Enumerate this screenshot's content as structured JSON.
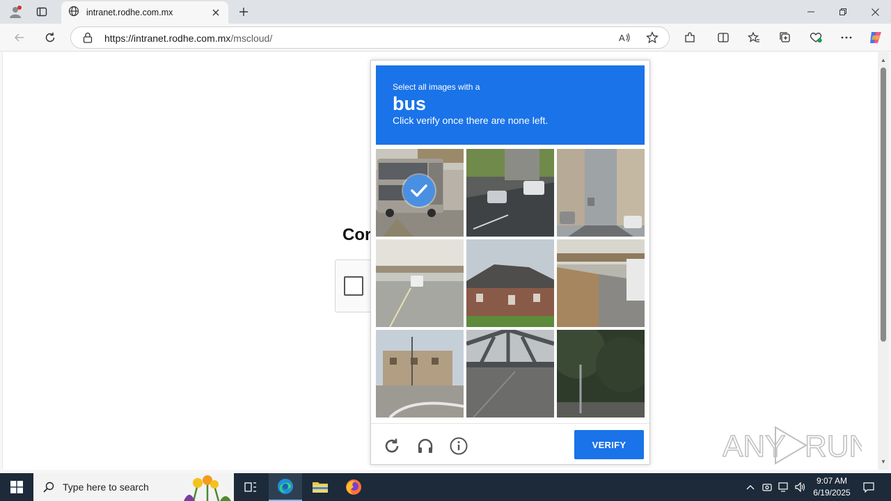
{
  "browser": {
    "tab_title": "intranet.rodhe.com.mx",
    "url_host": "https://intranet.rodhe.com.mx",
    "url_path": "/mscloud/"
  },
  "page": {
    "heading_partial": "Cor"
  },
  "captcha": {
    "prompt_pre": "Select all images with a",
    "target": "bus",
    "prompt_post": "Click verify once there are none left.",
    "verify_label": "VERIFY",
    "tiles": [
      {
        "scene": "double-decker bus on road",
        "selected": true
      },
      {
        "scene": "highway overpass with cars",
        "selected": false
      },
      {
        "scene": "city street with buildings",
        "selected": false
      },
      {
        "scene": "freeway with overpass",
        "selected": false
      },
      {
        "scene": "brick house",
        "selected": false
      },
      {
        "scene": "road with truck",
        "selected": false
      },
      {
        "scene": "apartment building",
        "selected": false
      },
      {
        "scene": "bridge truss",
        "selected": false
      },
      {
        "scene": "trees and pole",
        "selected": false
      }
    ]
  },
  "watermark": {
    "text_left": "ANY",
    "text_right": "RUN"
  },
  "taskbar": {
    "search_placeholder": "Type here to search",
    "time": "9:07 AM",
    "date": "6/19/2025"
  },
  "colors": {
    "captcha_blue": "#1a73e8",
    "check_blue": "#4a90e2",
    "taskbar": "#1c2a3a"
  }
}
